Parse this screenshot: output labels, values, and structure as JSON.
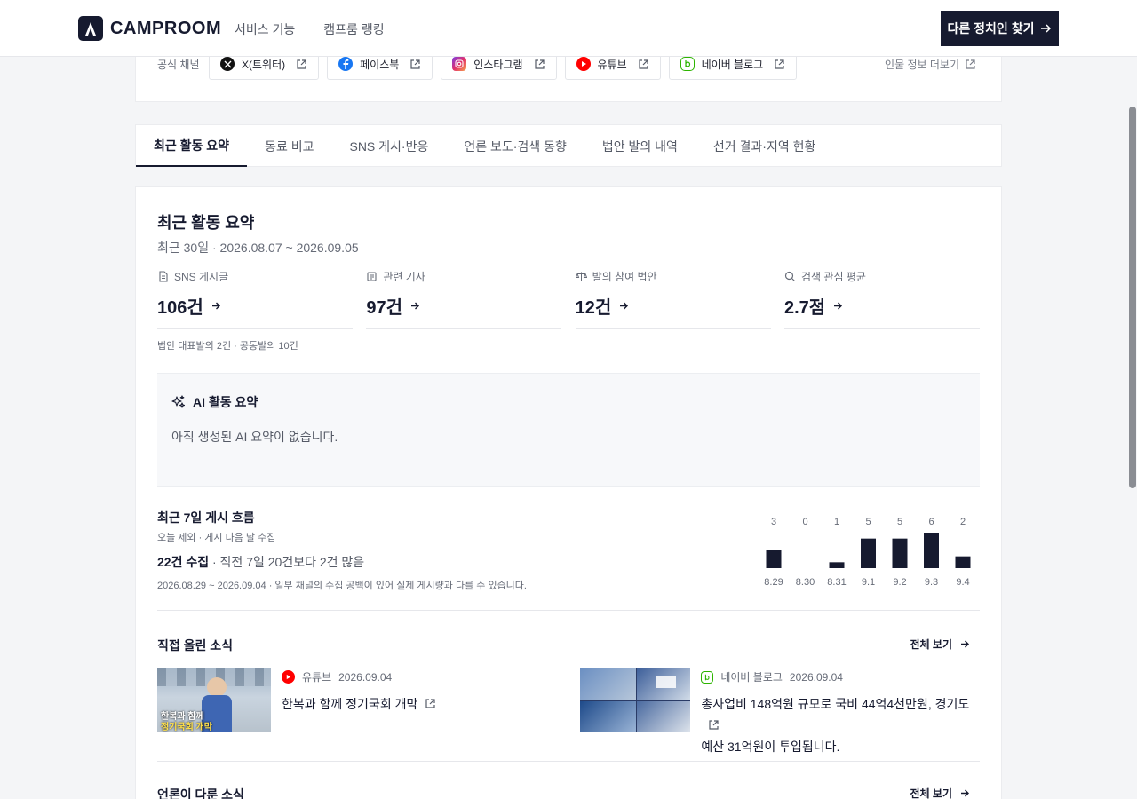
{
  "header": {
    "logo_text": "CAMPROOM",
    "nav": [
      "서비스 기능",
      "캠프룸 랭킹"
    ],
    "cta_label": "다른 정치인 찾기"
  },
  "channels": {
    "label": "공식 채널",
    "items": [
      {
        "name": "X(트위터)",
        "icon": "x-icon"
      },
      {
        "name": "페이스북",
        "icon": "facebook-icon"
      },
      {
        "name": "인스타그램",
        "icon": "instagram-icon"
      },
      {
        "name": "유튜브",
        "icon": "youtube-icon"
      },
      {
        "name": "네이버 블로그",
        "icon": "naver-blog-icon"
      }
    ],
    "more_label": "인물 정보 더보기"
  },
  "tabs": [
    "최근 활동 요약",
    "동료 비교",
    "SNS 게시·반응",
    "언론 보도·검색 동향",
    "법안 발의 내역",
    "선거 결과·지역 현황"
  ],
  "summary": {
    "title": "최근 활동 요약",
    "period": "최근 30일 · 2026.08.07 ~ 2026.09.05",
    "stats": [
      {
        "label": "SNS 게시글",
        "value": "106건",
        "icon": "document-icon"
      },
      {
        "label": "관련 기사",
        "value": "97건",
        "icon": "newspaper-icon"
      },
      {
        "label": "발의 참여 법안",
        "value": "12건",
        "icon": "scale-icon"
      },
      {
        "label": "검색 관심 평균",
        "value": "2.7점",
        "icon": "search-icon"
      }
    ],
    "note": "법안 대표발의 2건 · 공동발의 10건"
  },
  "ai": {
    "title": "AI 활동 요약",
    "text": "아직 생성된 AI 요약이 없습니다."
  },
  "weekly": {
    "title": "최근 7일 게시 흐름",
    "subtitle": "오늘 제외 · 게시 다음 날 수집",
    "count_bold": "22건 수집",
    "count_rest": " · 직전 7일 20건보다 2건 많음",
    "note": "2026.08.29 ~ 2026.09.04 · 일부 채널의 수집 공백이 있어 실제 게시량과 다를 수 있습니다."
  },
  "chart_data": {
    "type": "bar",
    "categories": [
      "8.29",
      "8.30",
      "8.31",
      "9.1",
      "9.2",
      "9.3",
      "9.4"
    ],
    "values": [
      3,
      0,
      1,
      5,
      5,
      6,
      2
    ],
    "ylim": [
      0,
      6
    ],
    "color": "#161a2f"
  },
  "posts": {
    "title": "직접 올린 소식",
    "see_all": "전체 보기",
    "items": [
      {
        "channel": "유튜브",
        "date": "2026.09.04",
        "title": "한복과 함께 정기국회 개막",
        "thumb_caption_1": "한복과 함께",
        "thumb_caption_2": "정기국회 개막"
      },
      {
        "channel": "네이버 블로그",
        "date": "2026.09.04",
        "title_line1": "총사업비 148억원 규모로 국비 44억4천만원, 경기도",
        "title_line2": "예산 31억원이 투입됩니다."
      }
    ]
  },
  "press": {
    "title": "언론이 다룬 소식",
    "see_all": "전체 보기"
  }
}
